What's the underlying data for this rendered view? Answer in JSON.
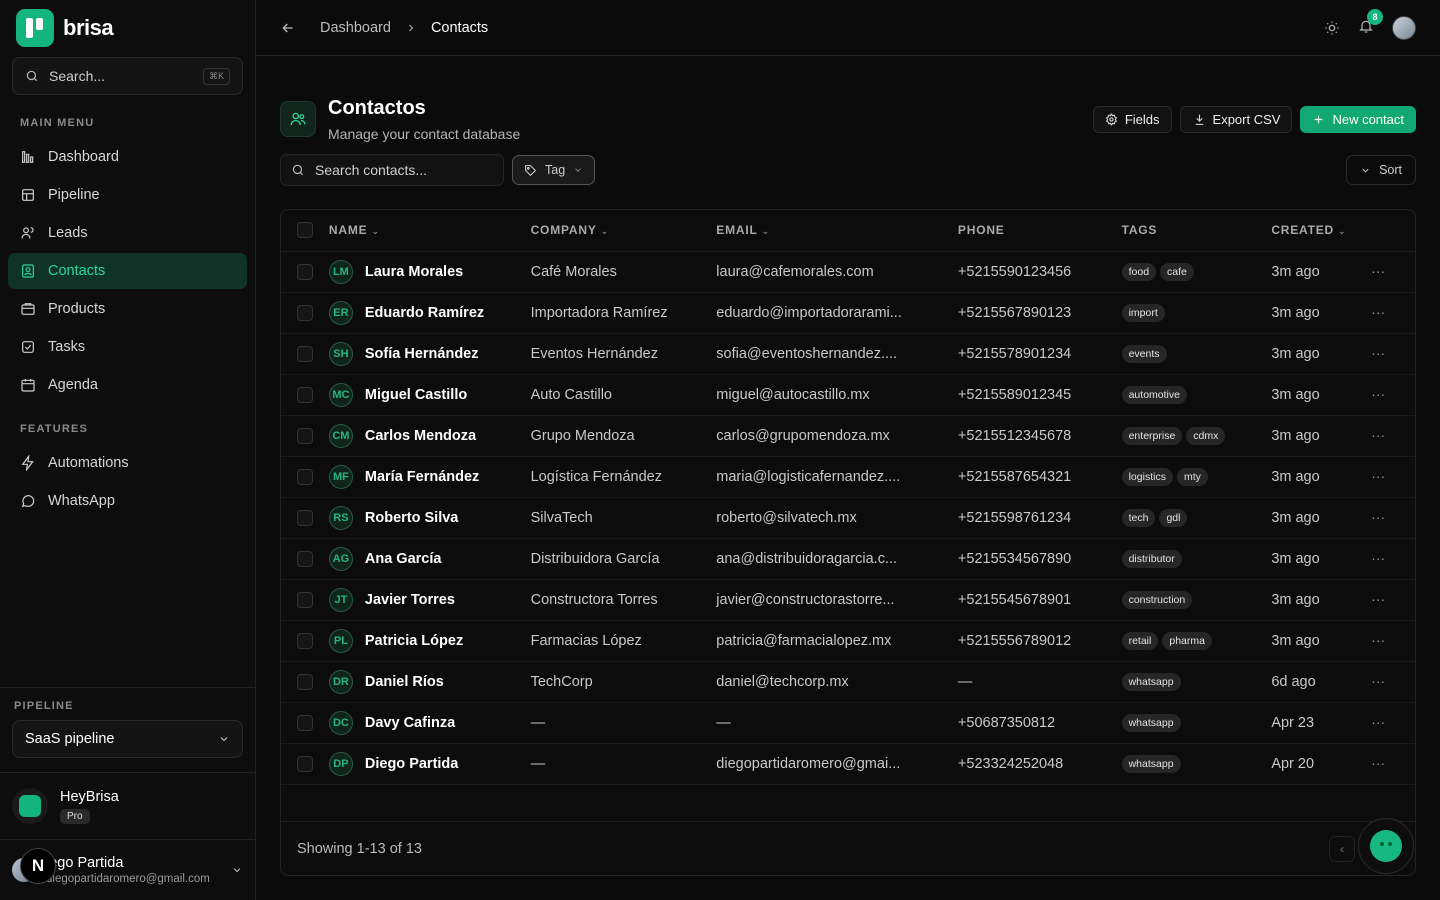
{
  "brand": {
    "name": "brisa"
  },
  "sidebar": {
    "search_label": "Search...",
    "search_kbd": "⌘K",
    "main_menu_label": "MAIN MENU",
    "main_items": [
      {
        "label": "Dashboard",
        "icon": "dashboard-icon"
      },
      {
        "label": "Pipeline",
        "icon": "pipeline-icon"
      },
      {
        "label": "Leads",
        "icon": "leads-icon"
      },
      {
        "label": "Contacts",
        "icon": "contacts-icon",
        "active": true
      },
      {
        "label": "Products",
        "icon": "products-icon"
      },
      {
        "label": "Tasks",
        "icon": "tasks-icon"
      },
      {
        "label": "Agenda",
        "icon": "agenda-icon"
      }
    ],
    "features_label": "FEATURES",
    "feature_items": [
      {
        "label": "Automations",
        "icon": "bolt-icon"
      },
      {
        "label": "WhatsApp",
        "icon": "whatsapp-icon"
      }
    ],
    "pipeline_label": "PIPELINE",
    "pipeline_value": "SaaS pipeline",
    "workspace_name": "HeyBrisa",
    "workspace_plan": "Pro",
    "user_name": "iego Partida",
    "user_email": "diegopartidaromero@gmail.com",
    "next_badge": "N"
  },
  "topbar": {
    "crumbs": [
      "Dashboard",
      "Contacts"
    ],
    "notification_count": "8"
  },
  "header": {
    "title": "Contactos",
    "subtitle": "Manage your contact database",
    "fields_label": "Fields",
    "export_label": "Export CSV",
    "new_label": "New contact"
  },
  "filters": {
    "search_placeholder": "Search contacts...",
    "tag_label": "Tag",
    "sort_label": "Sort"
  },
  "table": {
    "columns": [
      "NAME",
      "COMPANY",
      "EMAIL",
      "PHONE",
      "TAGS",
      "CREATED"
    ],
    "rows": [
      {
        "initials": "LM",
        "name": "Laura Morales",
        "company": "Café Morales",
        "email": "laura@cafemorales.com",
        "phone": "+5215590123456",
        "tags": [
          "food",
          "cafe"
        ],
        "created": "3m ago"
      },
      {
        "initials": "ER",
        "name": "Eduardo Ramírez",
        "company": "Importadora Ramírez",
        "email": "eduardo@importadorarami...",
        "phone": "+5215567890123",
        "tags": [
          "import"
        ],
        "created": "3m ago"
      },
      {
        "initials": "SH",
        "name": "Sofía Hernández",
        "company": "Eventos Hernández",
        "email": "sofia@eventoshernandez....",
        "phone": "+5215578901234",
        "tags": [
          "events"
        ],
        "created": "3m ago"
      },
      {
        "initials": "MC",
        "name": "Miguel Castillo",
        "company": "Auto Castillo",
        "email": "miguel@autocastillo.mx",
        "phone": "+5215589012345",
        "tags": [
          "automotive"
        ],
        "created": "3m ago"
      },
      {
        "initials": "CM",
        "name": "Carlos Mendoza",
        "company": "Grupo Mendoza",
        "email": "carlos@grupomendoza.mx",
        "phone": "+5215512345678",
        "tags": [
          "enterprise",
          "cdmx"
        ],
        "created": "3m ago"
      },
      {
        "initials": "MF",
        "name": "María Fernández",
        "company": "Logística Fernández",
        "email": "maria@logisticafernandez....",
        "phone": "+5215587654321",
        "tags": [
          "logistics",
          "mty"
        ],
        "created": "3m ago"
      },
      {
        "initials": "RS",
        "name": "Roberto Silva",
        "company": "SilvaTech",
        "email": "roberto@silvatech.mx",
        "phone": "+5215598761234",
        "tags": [
          "tech",
          "gdl"
        ],
        "created": "3m ago"
      },
      {
        "initials": "AG",
        "name": "Ana García",
        "company": "Distribuidora García",
        "email": "ana@distribuidoragarcia.c...",
        "phone": "+5215534567890",
        "tags": [
          "distributor"
        ],
        "created": "3m ago"
      },
      {
        "initials": "JT",
        "name": "Javier Torres",
        "company": "Constructora Torres",
        "email": "javier@constructorastorre...",
        "phone": "+5215545678901",
        "tags": [
          "construction"
        ],
        "created": "3m ago"
      },
      {
        "initials": "PL",
        "name": "Patricia López",
        "company": "Farmacias López",
        "email": "patricia@farmacialopez.mx",
        "phone": "+5215556789012",
        "tags": [
          "retail",
          "pharma"
        ],
        "created": "3m ago"
      },
      {
        "initials": "DR",
        "name": "Daniel Ríos",
        "company": "TechCorp",
        "email": "daniel@techcorp.mx",
        "phone": "—",
        "tags": [
          "whatsapp"
        ],
        "created": "6d ago"
      },
      {
        "initials": "DC",
        "name": "Davy Cafinza",
        "company": "—",
        "email": "—",
        "phone": "+50687350812",
        "tags": [
          "whatsapp"
        ],
        "created": "Apr 23"
      },
      {
        "initials": "DP",
        "name": "Diego Partida",
        "company": "—",
        "email": "diegopartidaromero@gmai...",
        "phone": "+523324252048",
        "tags": [
          "whatsapp"
        ],
        "created": "Apr 20"
      }
    ],
    "footer": "Showing 1-13 of 13",
    "row_menu": "···"
  },
  "colors": {
    "accent": "#15b57f",
    "active_bg": "#0f3326"
  }
}
